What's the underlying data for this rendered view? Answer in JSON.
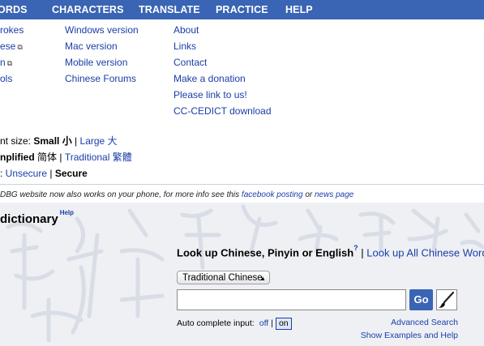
{
  "nav": {
    "items": [
      "ORDS",
      "CHARACTERS",
      "TRANSLATE",
      "PRACTICE",
      "HELP"
    ]
  },
  "menu": {
    "col1": [
      "rokes",
      "ese",
      "n",
      "ols"
    ],
    "col2": [
      "Windows version",
      "Mac version",
      "Mobile version",
      "Chinese Forums"
    ],
    "col3": [
      "About",
      "Links",
      "Contact",
      "Make a donation",
      "Please link to us!",
      "CC-CEDICT download"
    ]
  },
  "settings": {
    "font_prefix": "nt size: ",
    "font_small": "Small 小",
    "font_sep": " | ",
    "font_large": "Large 大",
    "script_current": "nplified",
    "script_current_cn": " 简体",
    "script_sep": " | ",
    "script_other": "Traditional 繁體",
    "ssl_prefix": ": ",
    "ssl_unsecure": "Unsecure",
    "ssl_sep": " | ",
    "ssl_secure": "Secure"
  },
  "notice": {
    "text_before": "DBG website now also works on your phone, for more info see this ",
    "link1": "facebook posting",
    "mid": " or ",
    "link2": "news page"
  },
  "dictionary": {
    "title": "dictionary",
    "help": "Help"
  },
  "lookup": {
    "label": "Look up Chinese, Pinyin or English",
    "help_mark": "?",
    "sep": " | ",
    "all_words": "Look up All Chinese Words in"
  },
  "search": {
    "select_value": "Traditional Chinese",
    "input_value": "",
    "go_label": "Go"
  },
  "autocomplete": {
    "label": "Auto complete input:",
    "off": "off",
    "sep": "|",
    "on": "on"
  },
  "links": {
    "advanced": "Advanced Search",
    "examples": "Show Examples and Help"
  },
  "colors": {
    "nav_bg": "#3a64b4",
    "link": "#1a3ea8",
    "lower_bg": "#eef0f4"
  }
}
